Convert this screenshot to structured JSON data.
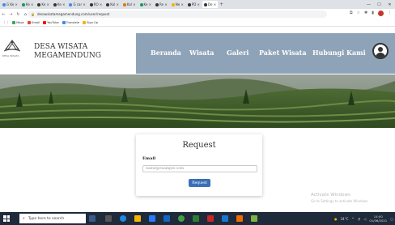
{
  "browser": {
    "tabs": [
      {
        "label": "G Ke ×",
        "fav": "#4285f4"
      },
      {
        "label": "Ke ×",
        "fav": "#0f9d58"
      },
      {
        "label": "Ke ×",
        "fav": "#333333"
      },
      {
        "label": "Ke ×",
        "fav": "#333333"
      },
      {
        "label": "G car ×",
        "fav": "#4285f4"
      },
      {
        "label": "RO ×",
        "fav": "#333333"
      },
      {
        "label": "Kol ×",
        "fav": "#333333"
      },
      {
        "label": "Kol ×",
        "fav": "#e37400"
      },
      {
        "label": "Ke ×",
        "fav": "#0f9d58"
      },
      {
        "label": "Re ×",
        "fav": "#333333"
      },
      {
        "label": "Ne ×",
        "fav": "#f4b400"
      },
      {
        "label": "PD ×",
        "fav": "#333333"
      },
      {
        "label": "De ×",
        "fav": "#333333"
      }
    ],
    "new_tab": "+",
    "window_controls": {
      "minimize": "—",
      "maximize": "☐",
      "close": "✕"
    },
    "url": "desawisatamegamendung.com/user/request",
    "bookmarks": [
      {
        "label": "Maps",
        "color": "#34a853"
      },
      {
        "label": "Gmail",
        "color": "#ea4335"
      },
      {
        "label": "YouTube",
        "color": "#ff0000"
      },
      {
        "label": "Translate",
        "color": "#4285f4"
      },
      {
        "label": "Sign Up",
        "color": "#f4b400"
      }
    ]
  },
  "site": {
    "brand_line1": "DESA WISATA",
    "brand_line2": "MEGAMENDUNG",
    "logo_caption": "DESA WISATA",
    "nav": [
      "Beranda",
      "Wisata",
      "Galeri",
      "Paket Wisata",
      "Hubungi Kami"
    ],
    "accent_color": "#8fa3b8"
  },
  "request_form": {
    "title": "Request",
    "email_label": "Email",
    "email_placeholder": "name@example.com",
    "email_value": "",
    "submit_label": "Request",
    "button_color": "#3b6fb6"
  },
  "watermark": {
    "line1": "Activate Windows",
    "line2": "Go to Settings to activate Windows."
  },
  "taskbar": {
    "search_placeholder": "Type here to search",
    "temperature": "34°C",
    "time": "14:00",
    "date": "01/06/2021"
  }
}
